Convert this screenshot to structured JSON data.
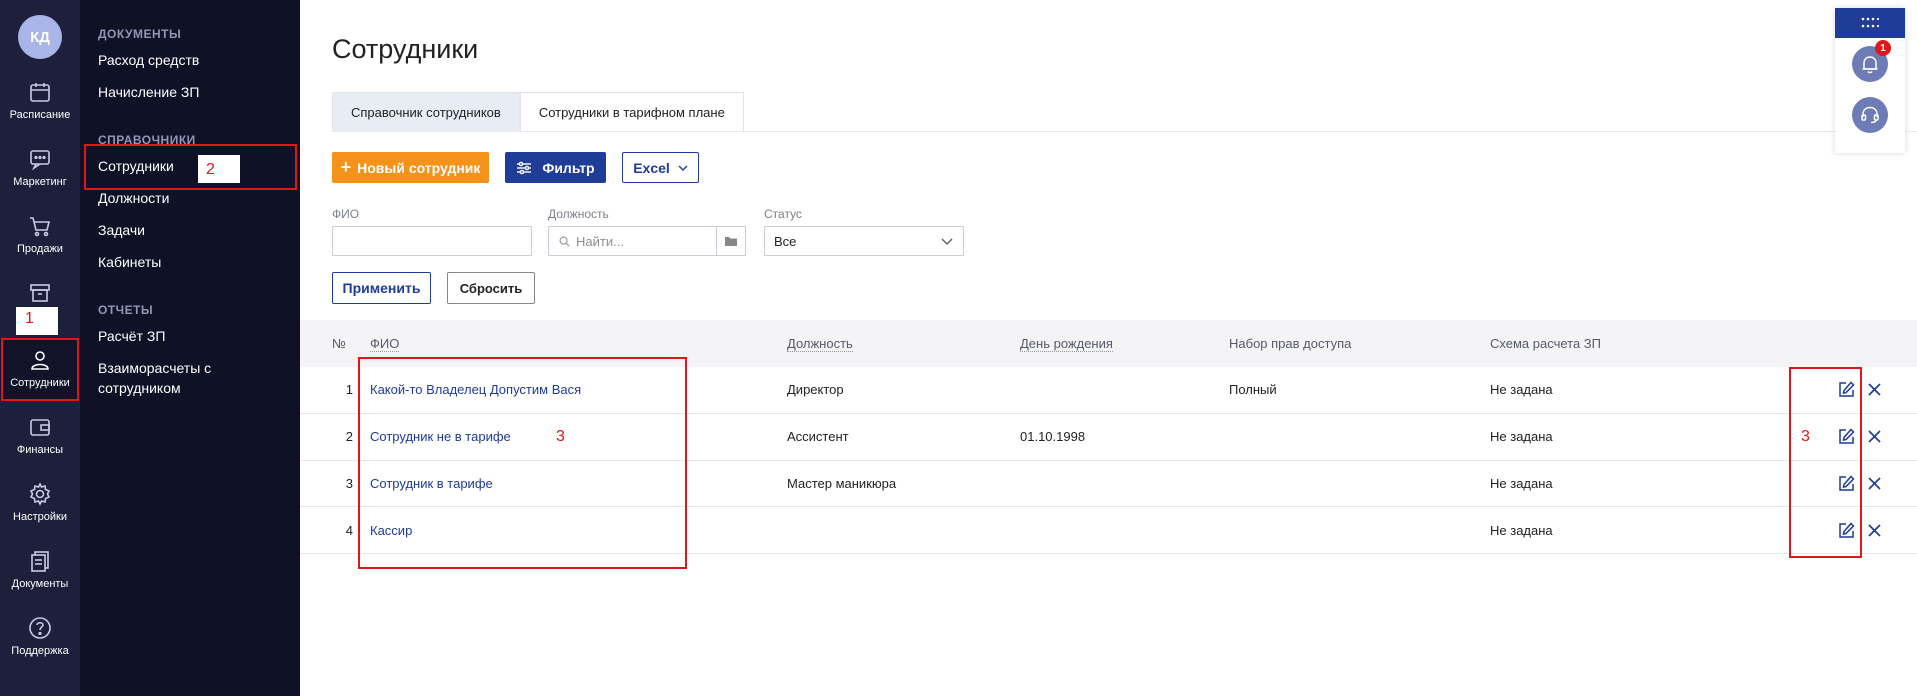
{
  "user": {
    "initials": "КД"
  },
  "rail": [
    {
      "label": "Расписание"
    },
    {
      "label": "Маркетинг"
    },
    {
      "label": "Продажи"
    },
    {
      "label": ""
    },
    {
      "label": "Сотрудники"
    },
    {
      "label": "Финансы"
    },
    {
      "label": "Настройки"
    },
    {
      "label": "Документы"
    },
    {
      "label": "Поддержка"
    }
  ],
  "submenu": {
    "documents_header": "ДОКУМЕНТЫ",
    "documents": [
      "Расход средств",
      "Начисление ЗП"
    ],
    "refs_header": "СПРАВОЧНИКИ",
    "refs": [
      "Сотрудники",
      "Должности",
      "Задачи",
      "Кабинеты"
    ],
    "reports_header": "ОТЧЕТЫ",
    "reports": [
      "Расчёт ЗП",
      "Взаиморасчеты с",
      "сотрудником"
    ]
  },
  "page": {
    "title": "Сотрудники",
    "tabs": [
      "Справочник сотрудников",
      "Сотрудники в тарифном плане"
    ]
  },
  "toolbar": {
    "new_label": "Новый сотрудник",
    "filter_label": "Фильтр",
    "excel_label": "Excel"
  },
  "filters": {
    "fio_label": "ФИО",
    "fio_value": "",
    "position_label": "Должность",
    "position_placeholder": "Найти...",
    "status_label": "Статус",
    "status_value": "Все",
    "apply_label": "Применить",
    "reset_label": "Сбросить"
  },
  "table": {
    "headers": [
      "№",
      "ФИО",
      "Должность",
      "День рождения",
      "Набор прав доступа",
      "Схема расчета ЗП"
    ],
    "rows": [
      {
        "num": "1",
        "name": "Какой-то Владелец Допустим Вася",
        "position": "Директор",
        "birthday": "",
        "rights": "Полный",
        "scheme": "Не задана"
      },
      {
        "num": "2",
        "name": "Сотрудник не в тарифе",
        "position": "Ассистент",
        "birthday": "01.10.1998",
        "rights": "",
        "scheme": "Не задана"
      },
      {
        "num": "3",
        "name": "Сотрудник в тарифе",
        "position": "Мастер маникюра",
        "birthday": "",
        "rights": "",
        "scheme": "Не задана"
      },
      {
        "num": "4",
        "name": "Кассир",
        "position": "",
        "birthday": "",
        "rights": "",
        "scheme": "Не задана"
      }
    ]
  },
  "notifications": {
    "count": "1"
  },
  "annotations": {
    "a1": "1",
    "a2": "2",
    "a3_table": "3",
    "a3_actions": "3"
  },
  "colors": {
    "rail": "#1e1f3a",
    "submenu": "#0f1127",
    "accent": "#1f3c96",
    "orange": "#f49219",
    "annotation": "#e0161b"
  }
}
